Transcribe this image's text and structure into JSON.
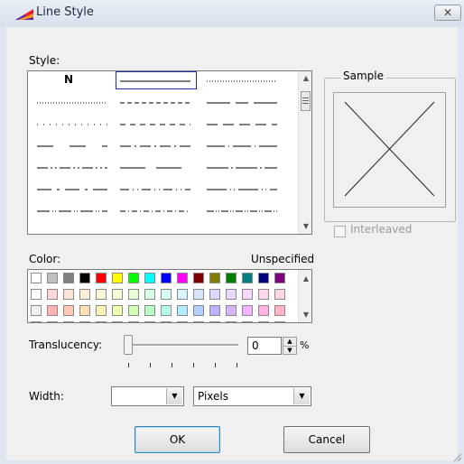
{
  "window": {
    "title": "Line Style",
    "close_glyph": "✕"
  },
  "style": {
    "label": "Style:",
    "first_item": "N",
    "patterns": [
      "none",
      "solid",
      "dot",
      "dense-dot",
      "short-dash",
      "long-short",
      "sparse-dot",
      "med-dash",
      "long-dash",
      "wide-gap",
      "dash-dot",
      "long-dot",
      "dash-dot-dot",
      "long-dot2",
      "long-dash2",
      "dash-space",
      "dash-dot-sp",
      "long-gap",
      "dash-dotdot",
      "dot-dash-mix",
      "dash-mix"
    ]
  },
  "sample": {
    "legend": "Sample"
  },
  "interleaved": {
    "label": "Interleaved",
    "checked": false,
    "enabled": false
  },
  "color": {
    "label": "Color:",
    "current": "Unspecified",
    "rows": [
      [
        "#ffffff",
        "#c0c0c0",
        "#808080",
        "#000000",
        "#ff0000",
        "#ffff00",
        "#00ff00",
        "#00ffff",
        "#0000ff",
        "#ff00ff",
        "#800000",
        "#808000",
        "#008000",
        "#008080",
        "#000080",
        "#800080"
      ],
      [
        "#ffffff",
        "#ffd7d7",
        "#ffe3d7",
        "#ffeed7",
        "#fff9d7",
        "#f5ffd7",
        "#e6ffd7",
        "#d7ffe1",
        "#d7fff5",
        "#d7f5ff",
        "#d7e6ff",
        "#dcd7ff",
        "#ebd7ff",
        "#f9d7ff",
        "#ffd7f0",
        "#ffd7e1"
      ],
      [
        "#f0f0f0",
        "#ffb3b3",
        "#ffc9b3",
        "#ffe0b3",
        "#fff5b3",
        "#ebffb3",
        "#d1ffb3",
        "#b3ffc4",
        "#b3ffeb",
        "#b3ebff",
        "#b3d1ff",
        "#bab3ff",
        "#d6b3ff",
        "#f2b3ff",
        "#ffb3e0",
        "#ffb3c4"
      ],
      [
        "#e0e0e0",
        "#ff8f8f",
        "#ffad8f",
        "#ffd18f",
        "#fff08f",
        "#e0ff8f",
        "#bcff8f",
        "#8fffa8",
        "#8fffe0",
        "#8fe0ff",
        "#8fbcff",
        "#998fff",
        "#c28fff",
        "#eb8fff",
        "#ff8fd1",
        "#ff8fa8"
      ]
    ]
  },
  "translucency": {
    "label": "Translucency:",
    "value": "0",
    "unit": "%",
    "slider_level": 0
  },
  "width": {
    "label": "Width:",
    "value": "",
    "unit": "Pixels"
  },
  "buttons": {
    "ok": "OK",
    "cancel": "Cancel"
  },
  "icons": {
    "scroll_up": "▲",
    "scroll_down": "▼",
    "dropdown": "▼",
    "spin_up": "▲",
    "spin_down": "▼"
  }
}
